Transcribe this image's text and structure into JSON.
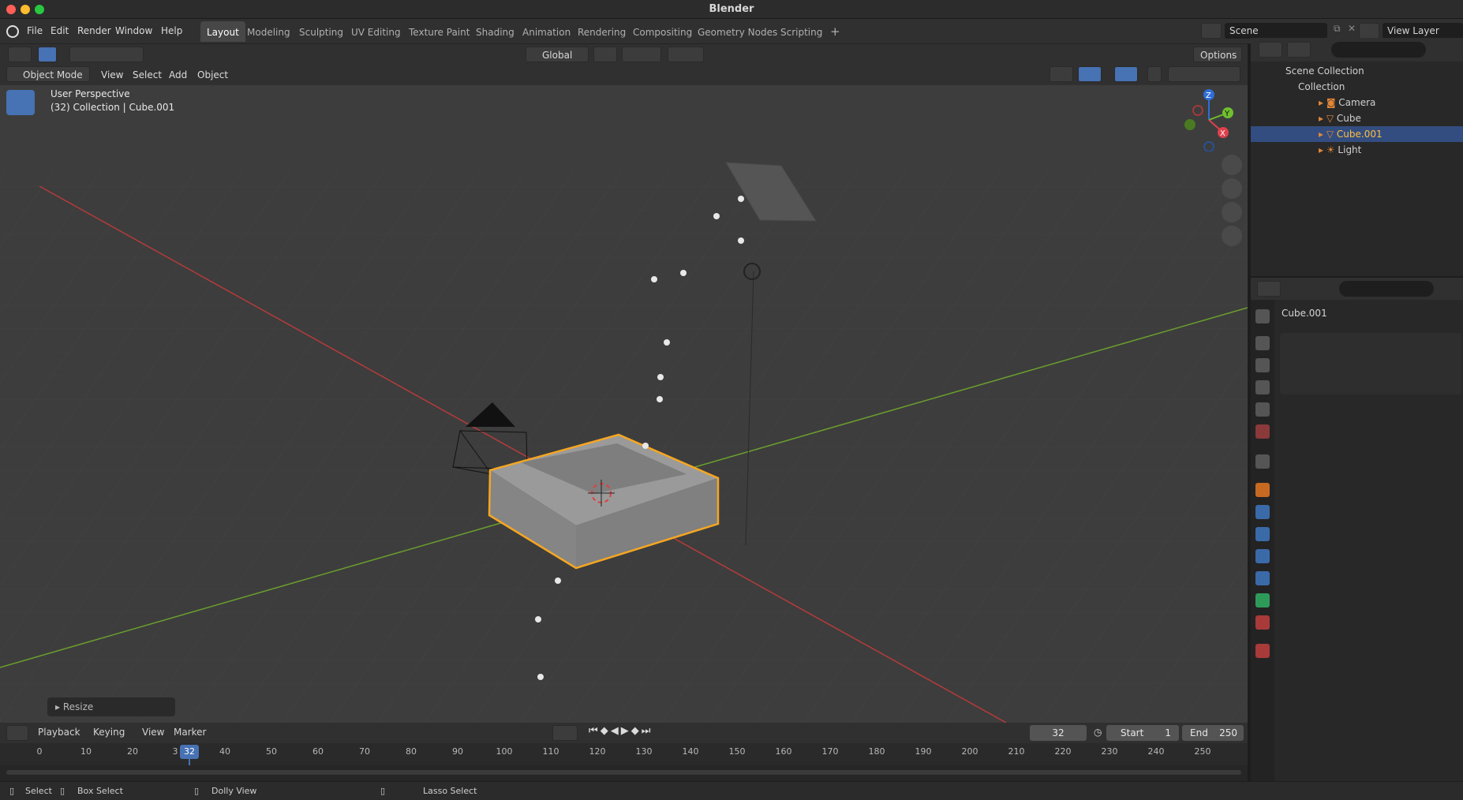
{
  "app": {
    "title": "Blender"
  },
  "menubar": {
    "items": [
      "File",
      "Edit",
      "Render",
      "Window",
      "Help"
    ],
    "workspaces": [
      "Layout",
      "Modeling",
      "Sculpting",
      "UV Editing",
      "Texture Paint",
      "Shading",
      "Animation",
      "Rendering",
      "Compositing",
      "Geometry Nodes",
      "Scripting"
    ],
    "active_workspace": "Layout",
    "add_tab": "+",
    "scene_label": "Scene",
    "view_layer_label": "View Layer"
  },
  "toolheader": {
    "transform_orientation": "Global",
    "options_label": "Options"
  },
  "viewport_header": {
    "mode": "Object Mode",
    "menus": [
      "View",
      "Select",
      "Add",
      "Object"
    ]
  },
  "viewport": {
    "perspective_label": "User Perspective",
    "context_label": "(32) Collection | Cube.001",
    "operator_panel_label": "Resize",
    "axis_labels": {
      "z": "Z",
      "y": "Y",
      "x": "X"
    }
  },
  "outliner": {
    "root": "Scene Collection",
    "collection": "Collection",
    "objects": [
      {
        "name": "Camera",
        "selected": false
      },
      {
        "name": "Cube",
        "selected": false
      },
      {
        "name": "Cube.001",
        "selected": true
      },
      {
        "name": "Light",
        "selected": false
      }
    ]
  },
  "properties": {
    "object_name": "Cube.001"
  },
  "timeline": {
    "menus": [
      "Playback",
      "Keying",
      "View",
      "Marker"
    ],
    "current_frame": "32",
    "start_label": "Start",
    "start_value": "1",
    "end_label": "End",
    "end_value": "250",
    "ticks": [
      "0",
      "10",
      "20",
      "3",
      "40",
      "50",
      "60",
      "70",
      "80",
      "90",
      "100",
      "110",
      "120",
      "130",
      "140",
      "150",
      "160",
      "170",
      "180",
      "190",
      "200",
      "210",
      "220",
      "230",
      "240",
      "250"
    ],
    "playhead_label": "32"
  },
  "statusbar": {
    "select": "Select",
    "box_select": "Box Select",
    "dolly_view": "Dolly View",
    "lasso_select": "Lasso Select"
  },
  "colors": {
    "selection_orange": "#f5a623",
    "accent_blue": "#4772b3",
    "x_axis": "#b53b3b",
    "y_axis": "#6a9e2e"
  }
}
